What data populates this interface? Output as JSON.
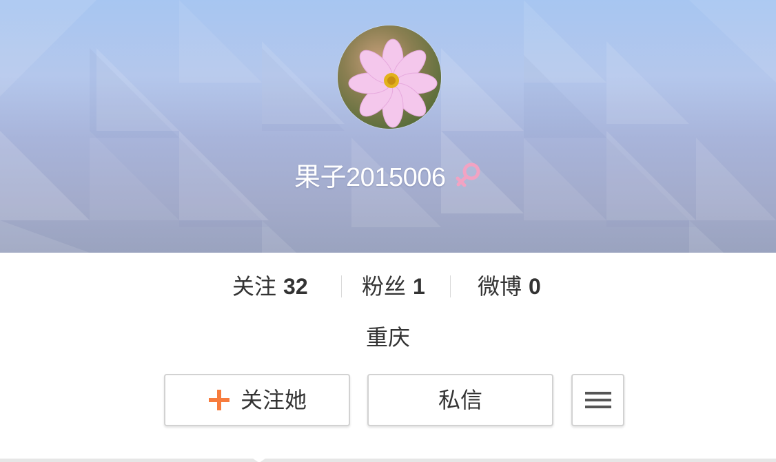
{
  "profile": {
    "name": "果子2015006",
    "gender": "female",
    "location": "重庆"
  },
  "stats": [
    {
      "label": "关注",
      "value": "32"
    },
    {
      "label": "粉丝",
      "value": "1"
    },
    {
      "label": "微博",
      "value": "0"
    }
  ],
  "actions": {
    "follow_label": "关注她",
    "message_label": "私信"
  },
  "icons": {
    "gender": "female-symbol-icon",
    "follow": "plus-icon",
    "more": "hamburger-menu-icon"
  },
  "colors": {
    "gender_pink": "#f2a3c3",
    "plus_orange": "#f77c3d",
    "menu_gray": "#555555",
    "cover_blue": "#a7c6f1"
  }
}
